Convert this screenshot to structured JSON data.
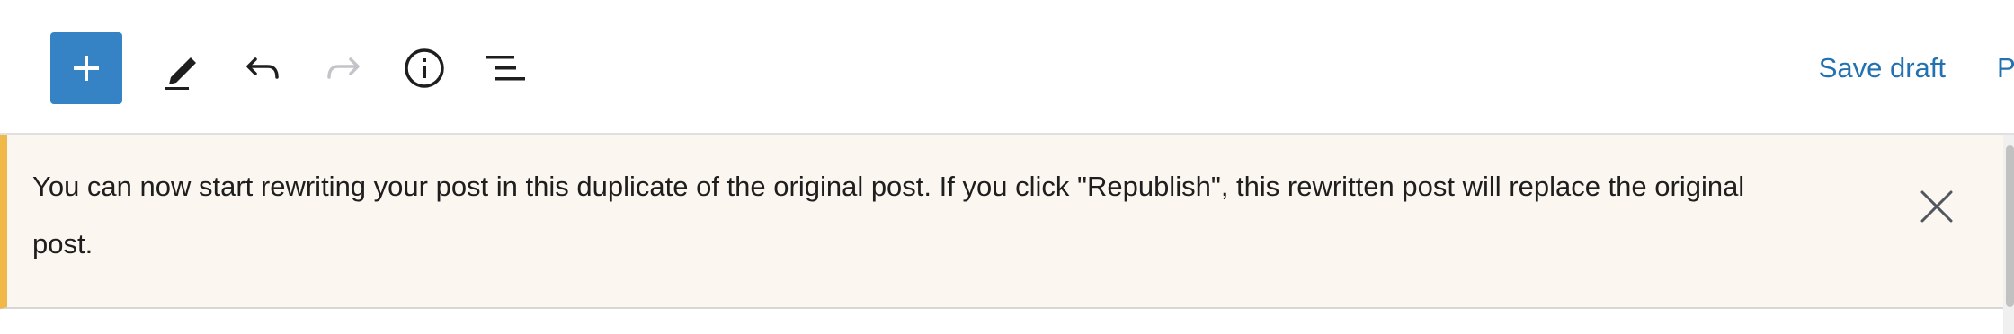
{
  "toolbar": {
    "icons": {
      "add": "plus-icon",
      "edit": "pencil-icon",
      "undo": "undo-icon",
      "redo": "redo-icon",
      "info": "info-icon",
      "outline": "list-view-icon"
    },
    "save_draft_label": "Save draft",
    "publish_label_partial": "P"
  },
  "notice": {
    "message": "You can now start rewriting your post in this duplicate of the original post. If you click \"Republish\", this rewritten post will replace the original post.",
    "close_icon": "close-icon"
  },
  "colors": {
    "accent": "#3582c4",
    "link": "#2271b1",
    "notice_background": "#fbf6ef",
    "notice_border": "#f0b849",
    "disabled_icon": "#c3c4c7"
  }
}
